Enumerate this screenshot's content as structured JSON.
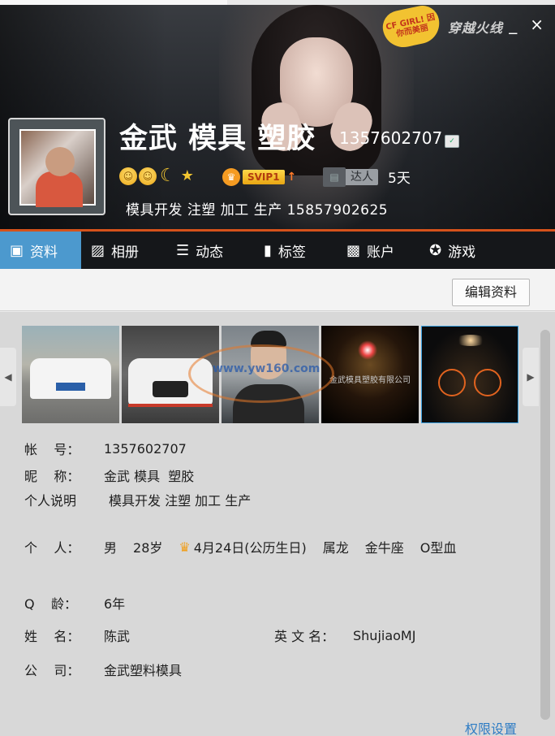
{
  "header": {
    "nickname": "金武 模具 塑胶",
    "qq_number": "1357602707",
    "vip_label": "SVIP1",
    "daren_label": "达人",
    "daren_days": "5天",
    "signature": "模具开发 注塑 加工 生产    15857902625",
    "brand_badge": "CF GIRL! 因你而美丽",
    "brand_logo": "穿越火线",
    "window_min": "_",
    "window_close": "×"
  },
  "tabs": [
    {
      "label": "资料",
      "icon": "profile-card-icon"
    },
    {
      "label": "相册",
      "icon": "album-icon"
    },
    {
      "label": "动态",
      "icon": "feed-list-icon"
    },
    {
      "label": "标签",
      "icon": "bookmark-icon"
    },
    {
      "label": "账户",
      "icon": "briefcase-icon"
    },
    {
      "label": "游戏",
      "icon": "game-icon"
    }
  ],
  "actions": {
    "edit_profile": "编辑资料"
  },
  "photos": {
    "watermark": "www.yw160.com",
    "photo4_text": "金武模具塑胶有限公司"
  },
  "profile": {
    "account_label": "帐    号：",
    "account_value": "1357602707",
    "nickname_label": "昵    称：",
    "nickname_value": "金武 模具  塑胶",
    "desc_label": "个人说明",
    "desc_value": "模具开发 注塑 加工 生产",
    "personal_label": "个    人：",
    "gender": "男",
    "age": "28岁",
    "birthday": "4月24日(公历生日)",
    "zodiac": "属龙",
    "constellation": "金牛座",
    "blood_type": "O型血",
    "qage_label": "Q    龄：",
    "qage_value": "6年",
    "name_label": "姓    名：",
    "name_value": "陈武",
    "english_label": "英 文 名：",
    "english_value": "ShujiaoMJ",
    "company_label": "公    司：",
    "company_value": "金武塑料模具"
  },
  "footer": {
    "permission_link": "权限设置"
  },
  "colors": {
    "tab_active": "#4c99ce",
    "accent_strip": "#d5521b",
    "link": "#2e7cc4"
  }
}
